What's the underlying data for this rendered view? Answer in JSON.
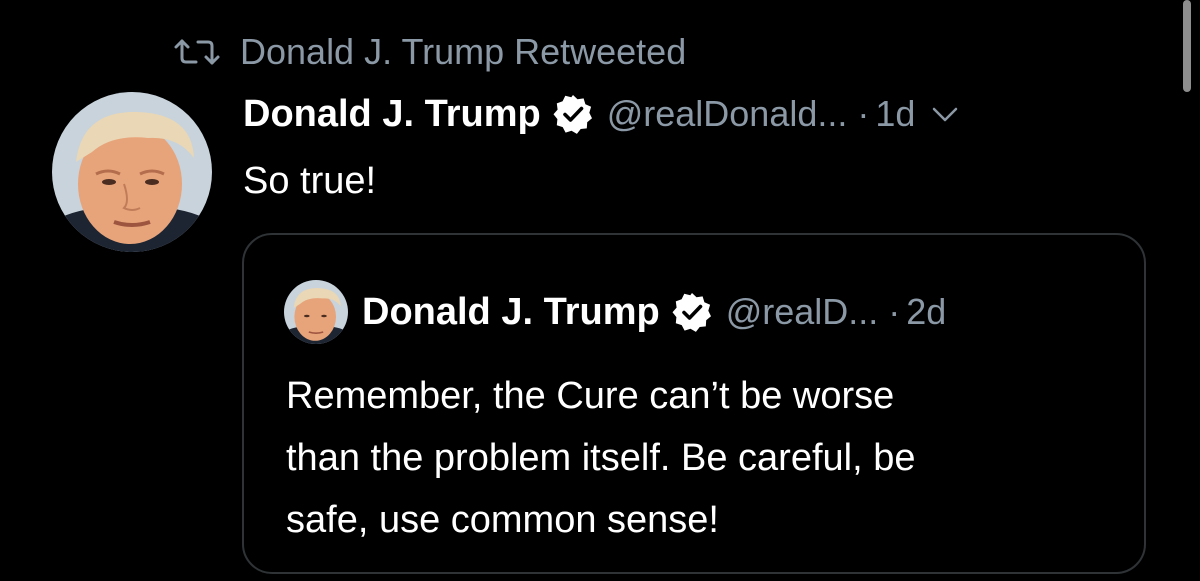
{
  "retweet": {
    "icon": "retweet-icon",
    "label": "Donald J. Trump Retweeted"
  },
  "tweet": {
    "author_name": "Donald J. Trump",
    "verified_icon": "verified-badge-icon",
    "handle": "@realDonald...",
    "separator": "·",
    "time": "1d",
    "menu_icon": "chevron-down-icon",
    "text": "So true!"
  },
  "quoted_tweet": {
    "author_name": "Donald J. Trump",
    "verified_icon": "verified-badge-icon",
    "handle": "@realD...",
    "separator": "·",
    "time": "2d",
    "text_lines": [
      "Remember, the Cure can’t be worse",
      "than the problem itself. Be careful, be",
      "safe, use common sense!"
    ]
  },
  "colors": {
    "background": "#000000",
    "primary_text": "#ffffff",
    "secondary_text": "#8b98a5",
    "border": "#2f3336"
  }
}
